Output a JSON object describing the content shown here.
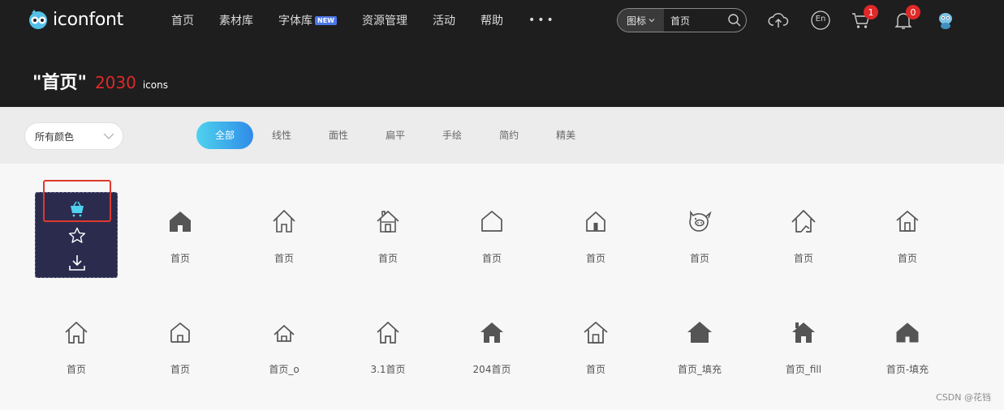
{
  "brand": {
    "name": "iconfont"
  },
  "nav": {
    "items": [
      {
        "label": "首页"
      },
      {
        "label": "素材库"
      },
      {
        "label": "字体库",
        "badge": "NEW"
      },
      {
        "label": "资源管理"
      },
      {
        "label": "活动"
      },
      {
        "label": "帮助"
      }
    ],
    "more": "•••"
  },
  "search": {
    "type_label": "图标",
    "value": "首页"
  },
  "header_icons": {
    "upload": "upload-cloud-icon",
    "language": "En",
    "cart_count": "1",
    "notification_count": "0"
  },
  "title": {
    "query": "\"首页\"",
    "count": "2030",
    "unit": "icons"
  },
  "filters": {
    "color_select": "所有颜色",
    "tabs": [
      "全部",
      "线性",
      "面性",
      "扁平",
      "手绘",
      "简约",
      "精美"
    ],
    "active_tab": "全部"
  },
  "icons_row1": [
    "首页",
    "首页",
    "首页",
    "首页",
    "首页",
    "首页",
    "首页",
    "首页"
  ],
  "icons_row2": [
    "首页",
    "首页",
    "首页_o",
    "3.1首页",
    "204首页",
    "首页",
    "首页_填充",
    "首页_fill",
    "首页-填充"
  ],
  "hover_actions": [
    "cart-add-icon",
    "star-icon",
    "download-icon"
  ],
  "accent": {
    "brand_blue": "#2f8ce8",
    "badge_red": "#e02828",
    "highlight": "#e0392b"
  },
  "watermark": "CSDN @花铛"
}
